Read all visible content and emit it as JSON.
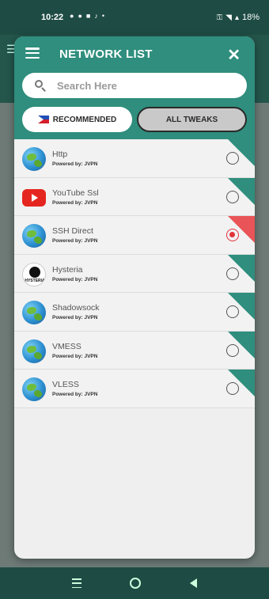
{
  "status_bar": {
    "time": "10:22",
    "left_icons": [
      "●",
      "●",
      "■",
      "♪",
      "•"
    ],
    "battery_text": "18%"
  },
  "modal": {
    "title": "NETWORK LIST",
    "close_label": "✕"
  },
  "search": {
    "placeholder": "Search Here",
    "value": ""
  },
  "tabs": {
    "recommended": "RECOMMENDED",
    "all": "ALL TWEAKS"
  },
  "colors": {
    "accent": "#2f8e7d",
    "selected": "#e2323a"
  },
  "networks": [
    {
      "name": "Http",
      "powered": "Powered by: JVPN",
      "icon": "globe-icon",
      "selected": false
    },
    {
      "name": "YouTube Ssl",
      "powered": "Powered by: JVPN",
      "icon": "youtube-icon",
      "selected": false
    },
    {
      "name": "SSH Direct",
      "powered": "Powered by: JVPN",
      "icon": "globe-icon",
      "selected": true
    },
    {
      "name": "Hysteria",
      "powered": "Powered by: JVPN",
      "icon": "hysteria-icon",
      "selected": false
    },
    {
      "name": "Shadowsock",
      "powered": "Powered by: JVPN",
      "icon": "globe-icon",
      "selected": false
    },
    {
      "name": "VMESS",
      "powered": "Powered by: JVPN",
      "icon": "globe-icon",
      "selected": false
    },
    {
      "name": "VLESS",
      "powered": "Powered by: JVPN",
      "icon": "globe-icon",
      "selected": false
    }
  ]
}
